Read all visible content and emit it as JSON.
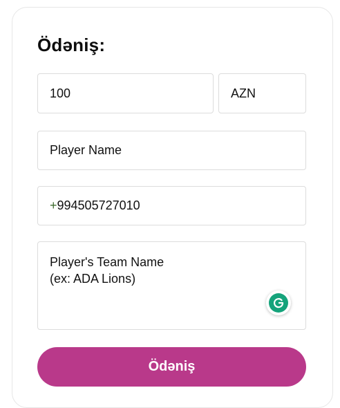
{
  "form": {
    "title": "Ödəniş:",
    "amount_value": "100",
    "currency_value": "AZN",
    "player_name_placeholder": "Player Name",
    "phone_plus": "+",
    "phone_digits": "994505727010",
    "team_placeholder": "Player's Team Name\n(ex: ADA Lions)",
    "submit_label": "Ödəniş"
  },
  "colors": {
    "accent": "#b9398a",
    "grammarly": "#15a37b"
  },
  "icons": {
    "grammarly": "grammarly-icon"
  }
}
